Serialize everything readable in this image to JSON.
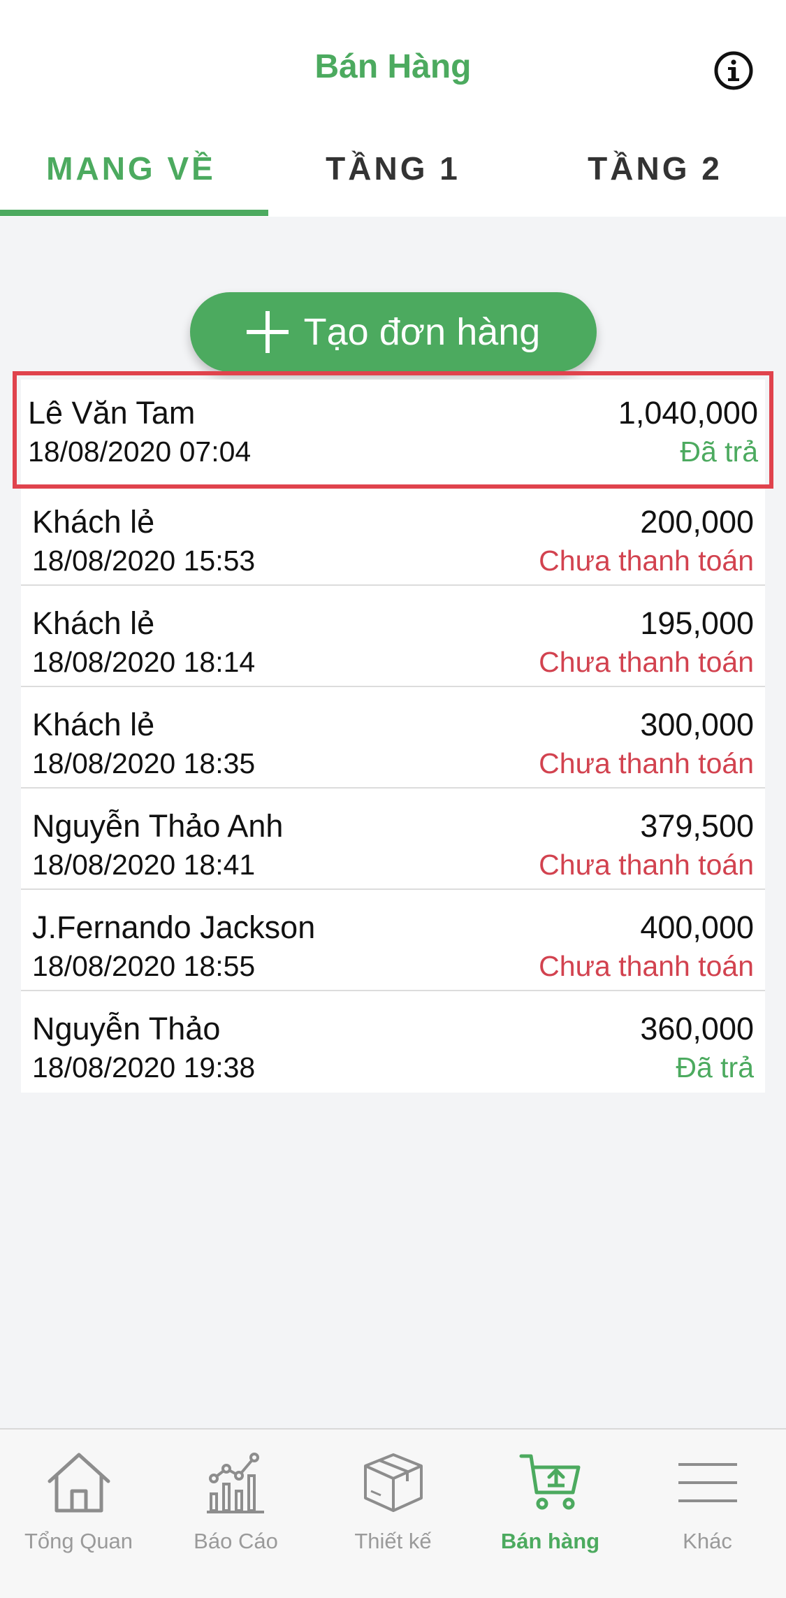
{
  "header": {
    "title": "Bán Hàng",
    "info_icon": "info-icon"
  },
  "tabs": [
    {
      "label": "MANG VỀ",
      "active": true
    },
    {
      "label": "TẦNG 1",
      "active": false
    },
    {
      "label": "TẦNG 2",
      "active": false
    }
  ],
  "create_order": {
    "label": "Tạo đơn hàng",
    "icon": "plus-icon"
  },
  "orders": [
    {
      "name": "Lê Văn Tam",
      "time": "18/08/2020 07:04",
      "amount": "1,040,000",
      "status": "Đã trả",
      "paid": true,
      "selected": true
    },
    {
      "name": "Khách lẻ",
      "time": "18/08/2020 15:53",
      "amount": "200,000",
      "status": "Chưa thanh toán",
      "paid": false
    },
    {
      "name": "Khách lẻ",
      "time": "18/08/2020 18:14",
      "amount": "195,000",
      "status": "Chưa thanh toán",
      "paid": false
    },
    {
      "name": "Khách lẻ",
      "time": "18/08/2020 18:35",
      "amount": "300,000",
      "status": "Chưa thanh toán",
      "paid": false
    },
    {
      "name": "Nguyễn Thảo Anh",
      "time": "18/08/2020 18:41",
      "amount": "379,500",
      "status": "Chưa thanh toán",
      "paid": false
    },
    {
      "name": "J.Fernando Jackson",
      "time": "18/08/2020 18:55",
      "amount": "400,000",
      "status": "Chưa thanh toán",
      "paid": false
    },
    {
      "name": "Nguyễn Thảo",
      "time": "18/08/2020 19:38",
      "amount": "360,000",
      "status": "Đã trả",
      "paid": true
    }
  ],
  "tabbar": [
    {
      "label": "Tổng Quan",
      "icon": "home-icon"
    },
    {
      "label": "Báo Cáo",
      "icon": "chart-icon"
    },
    {
      "label": "Thiết kế",
      "icon": "box-icon"
    },
    {
      "label": "Bán hàng",
      "icon": "cart-icon",
      "active": true
    },
    {
      "label": "Khác",
      "icon": "menu-icon"
    }
  ],
  "colors": {
    "accent": "#4caa5f",
    "unpaid": "#d2424f",
    "highlight": "#e0434d"
  }
}
